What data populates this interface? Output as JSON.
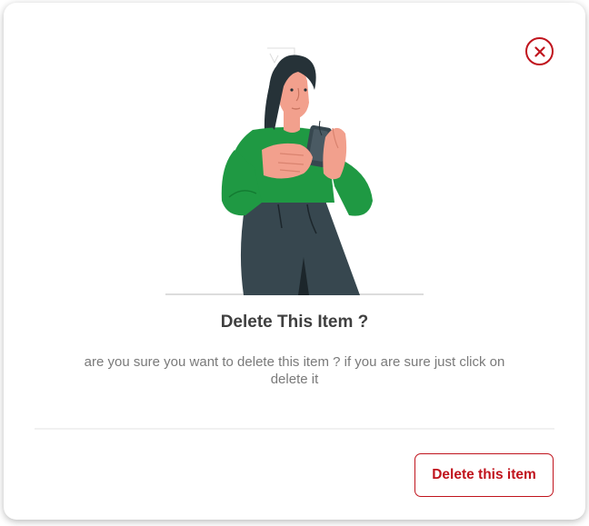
{
  "dialog": {
    "title": "Delete This Item ?",
    "message": "are you sure you want to delete this item ? if you are sure just click on delete it",
    "close_icon": "close-icon",
    "illustration": "woman-looking-at-phone",
    "delete_label": "Delete this item"
  },
  "colors": {
    "accent": "#c0141d",
    "title": "#3f3f3f",
    "message": "#7a7a7a",
    "shirt": "#1f9943",
    "pants": "#37474f",
    "skin": "#f2a08d",
    "hair": "#263238"
  }
}
